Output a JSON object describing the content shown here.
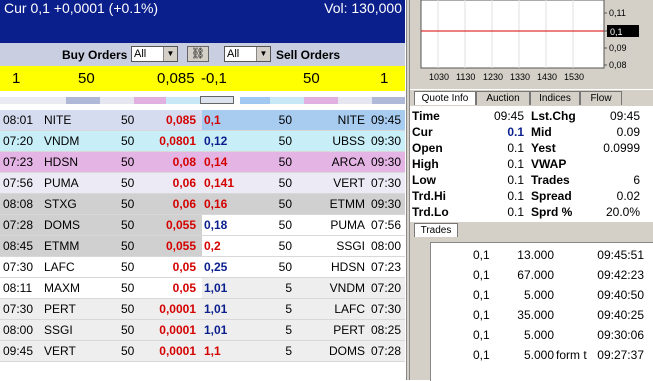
{
  "header": {
    "cur": "Cur 0,1 +0,0001 (+0.1%)",
    "vol": "Vol: 130,000"
  },
  "orders": {
    "buy_label": "Buy Orders",
    "sell_label": "Sell Orders",
    "buy_filter": "All",
    "sell_filter": "All"
  },
  "summary": {
    "bid_count": "1",
    "bid_size": "50",
    "bid_price": "0,085",
    "ask_price": "-0,1",
    "ask_size": "50",
    "ask_count": "1"
  },
  "bids": [
    {
      "time": "08:01",
      "mm": "NITE",
      "size": "50",
      "price": "0,085"
    },
    {
      "time": "07:20",
      "mm": "VNDM",
      "size": "50",
      "price": "0,0801"
    },
    {
      "time": "07:23",
      "mm": "HDSN",
      "size": "50",
      "price": "0,08"
    },
    {
      "time": "07:56",
      "mm": "PUMA",
      "size": "50",
      "price": "0,06"
    },
    {
      "time": "08:08",
      "mm": "STXG",
      "size": "50",
      "price": "0,06"
    },
    {
      "time": "07:28",
      "mm": "DOMS",
      "size": "50",
      "price": "0,055"
    },
    {
      "time": "08:45",
      "mm": "ETMM",
      "size": "50",
      "price": "0,055"
    },
    {
      "time": "07:30",
      "mm": "LAFC",
      "size": "50",
      "price": "0,05"
    },
    {
      "time": "08:11",
      "mm": "MAXM",
      "size": "50",
      "price": "0,05"
    },
    {
      "time": "07:30",
      "mm": "PERT",
      "size": "50",
      "price": "0,0001"
    },
    {
      "time": "08:00",
      "mm": "SSGI",
      "size": "50",
      "price": "0,0001"
    },
    {
      "time": "09:45",
      "mm": "VERT",
      "size": "50",
      "price": "0,0001"
    }
  ],
  "asks": [
    {
      "price": "0,1",
      "size": "50",
      "mm": "NITE",
      "time": "09:45"
    },
    {
      "price": "0,12",
      "size": "50",
      "mm": "UBSS",
      "time": "09:30"
    },
    {
      "price": "0,14",
      "size": "50",
      "mm": "ARCA",
      "time": "09:30"
    },
    {
      "price": "0,141",
      "size": "50",
      "mm": "VERT",
      "time": "07:30"
    },
    {
      "price": "0,16",
      "size": "50",
      "mm": "ETMM",
      "time": "09:30"
    },
    {
      "price": "0,18",
      "size": "50",
      "mm": "PUMA",
      "time": "07:56"
    },
    {
      "price": "0,2",
      "size": "50",
      "mm": "SSGI",
      "time": "08:00"
    },
    {
      "price": "0,25",
      "size": "50",
      "mm": "HDSN",
      "time": "07:23"
    },
    {
      "price": "1,01",
      "size": "5",
      "mm": "VNDM",
      "time": "07:20"
    },
    {
      "price": "1,01",
      "size": "5",
      "mm": "LAFC",
      "time": "07:30"
    },
    {
      "price": "1,01",
      "size": "5",
      "mm": "PERT",
      "time": "08:25"
    },
    {
      "price": "1,1",
      "size": "5",
      "mm": "DOMS",
      "time": "07:28"
    }
  ],
  "chart": {
    "x_ticks": [
      "1030",
      "1130",
      "1230",
      "1330",
      "1430",
      "1530"
    ],
    "y_ticks": [
      "0,11",
      "0,1",
      "0,09",
      "0,08"
    ],
    "current_label": "0,1"
  },
  "tabs": [
    "Quote Info",
    "Auction",
    "Indices",
    "Flow"
  ],
  "quote": {
    "rows": [
      {
        "l1": "Time",
        "v1": "09:45",
        "l2": "Lst.Chg",
        "v2": "09:45"
      },
      {
        "l1": "Cur",
        "v1": "0.1",
        "l2": "Mid",
        "v2": "0.09"
      },
      {
        "l1": "Open",
        "v1": "0.1",
        "l2": "Yest",
        "v2": "0.0999"
      },
      {
        "l1": "High",
        "v1": "0.1",
        "l2": "VWAP",
        "v2": ""
      },
      {
        "l1": "Low",
        "v1": "0.1",
        "l2": "Trades",
        "v2": "6"
      },
      {
        "l1": "Trd.Hi",
        "v1": "0.1",
        "l2": "Spread",
        "v2": "0.02"
      },
      {
        "l1": "Trd.Lo",
        "v1": "0.1",
        "l2": "Sprd %",
        "v2": "20.0%"
      }
    ]
  },
  "trades_tab": "Trades",
  "trades": [
    {
      "price": "0,1",
      "size": "13.000",
      "note": "",
      "time": "09:45:51"
    },
    {
      "price": "0,1",
      "size": "67.000",
      "note": "",
      "time": "09:42:23"
    },
    {
      "price": "0,1",
      "size": "5.000",
      "note": "",
      "time": "09:40:50"
    },
    {
      "price": "0,1",
      "size": "35.000",
      "note": "",
      "time": "09:40:25"
    },
    {
      "price": "0,1",
      "size": "5.000",
      "note": "",
      "time": "09:30:06"
    },
    {
      "price": "0,1",
      "size": "5.000",
      "note": "form t",
      "time": "09:27:37"
    }
  ]
}
